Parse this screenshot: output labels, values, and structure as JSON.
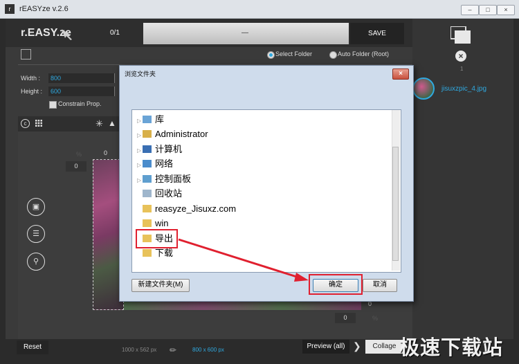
{
  "window": {
    "title": "rEASYze v.2.6",
    "icon": "app-icon",
    "buttons": [
      "minimize-icon",
      "maximize-icon",
      "close-icon"
    ]
  },
  "header": {
    "logo": "r.EASY.ze",
    "counter": "0/1",
    "progress_dash": "—",
    "progress": 0,
    "save": "SAVE"
  },
  "folder": {
    "select_folder": "Select Folder",
    "auto_folder": "Auto Folder (Root)"
  },
  "size": {
    "width_label": "Width :",
    "width_value": "800",
    "height_label": "Height :",
    "height_value": "600",
    "constrain": "Constrain Prop."
  },
  "canvas": {
    "pct1": "%",
    "zero_top": "0",
    "zero_left": "0",
    "zero_right": "0",
    "zero_bottom": "0",
    "pct2": "%"
  },
  "right": {
    "one": "1",
    "thumb_name": "jisuxzpic_4.jpg"
  },
  "bottom": {
    "reset": "Reset",
    "src_size": "1000 x 562 px",
    "dst_size": "800 x 600 px",
    "preview": "Preview (all)",
    "collage": "Collage"
  },
  "watermark": "极速下载站",
  "dialog": {
    "title": "浏览文件夹",
    "items": [
      {
        "label": "库",
        "icon": "library-icon",
        "arrow": true
      },
      {
        "label": "Administrator",
        "icon": "user-folder-icon",
        "arrow": true
      },
      {
        "label": "计算机",
        "icon": "computer-icon",
        "arrow": true
      },
      {
        "label": "网络",
        "icon": "network-icon",
        "arrow": true
      },
      {
        "label": "控制面板",
        "icon": "control-panel-icon",
        "arrow": true
      },
      {
        "label": "回收站",
        "icon": "recycle-bin-icon",
        "arrow": false
      },
      {
        "label": "reasyze_Jisuxz.com",
        "icon": "folder-icon",
        "arrow": false
      },
      {
        "label": "win",
        "icon": "folder-icon",
        "arrow": false
      },
      {
        "label": "导出",
        "icon": "folder-icon",
        "arrow": false
      },
      {
        "label": "下载",
        "icon": "folder-icon",
        "arrow": false
      }
    ],
    "new_folder": "新建文件夹(M)",
    "ok": "确定",
    "cancel": "取消"
  }
}
